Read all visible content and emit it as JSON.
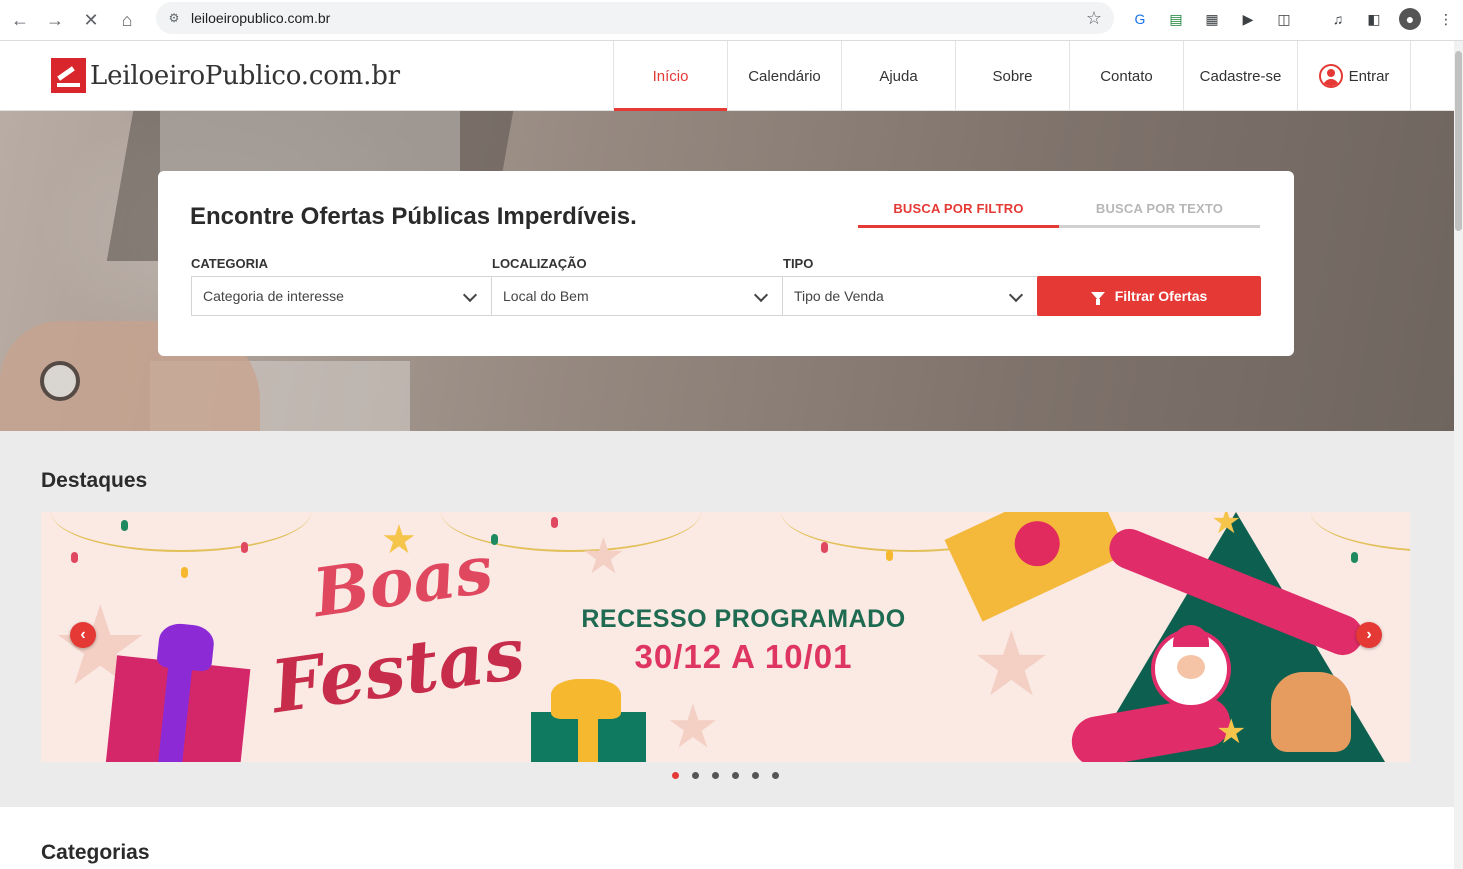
{
  "browser": {
    "url": "leiloeiropublico.com.br",
    "icons": [
      "back-icon",
      "forward-icon",
      "stop-icon",
      "home-icon",
      "site-settings-icon",
      "bookmark-star-icon",
      "translate-icon",
      "sheets-icon",
      "qr-icon",
      "play-icon",
      "extensions-icon",
      "media-icon",
      "sidepanel-icon",
      "profile-icon",
      "kebab-menu-icon"
    ]
  },
  "header": {
    "logo_text": "LeiloeiroPublico.com.br",
    "menu": [
      {
        "label": "Início",
        "active": true
      },
      {
        "label": "Calendário"
      },
      {
        "label": "Ajuda"
      },
      {
        "label": "Sobre"
      },
      {
        "label": "Contato"
      },
      {
        "label": "Cadastre-se"
      },
      {
        "label": "Entrar"
      }
    ]
  },
  "search": {
    "title": "Encontre Ofertas Públicas Imperdíveis.",
    "tabs": [
      "BUSCA POR FILTRO",
      "BUSCA POR TEXTO"
    ],
    "fields": [
      {
        "label": "CATEGORIA",
        "value": "Categoria de interesse"
      },
      {
        "label": "LOCALIZAÇÃO",
        "value": "Local do Bem"
      },
      {
        "label": "TIPO",
        "value": "Tipo de Venda"
      }
    ],
    "button": "Filtrar Ofertas"
  },
  "destaques": {
    "title": "Destaques",
    "banner": {
      "script_line1": "Boas",
      "script_line2": "Festas",
      "line1": "RECESSO PROGRAMADO",
      "line2": "30/12 A 10/01"
    },
    "prev": "‹",
    "next": "›",
    "slide_count": 6,
    "active_slide": 1
  },
  "categorias": {
    "title": "Categorias"
  },
  "colors": {
    "accent": "#e53935",
    "banner_green": "#1f6b52",
    "banner_pink": "#de3661"
  }
}
